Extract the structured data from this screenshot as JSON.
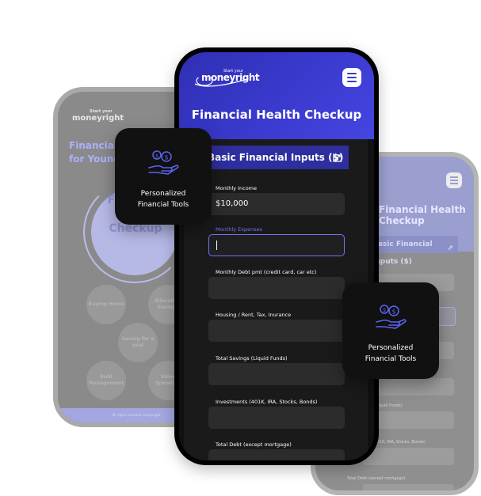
{
  "brand": {
    "start_text": "Start your",
    "name": "moneyright",
    "accent": "#3a3acf",
    "focus_color": "#6f75f2"
  },
  "left_screen": {
    "title": "Financial Health Checkup for Young",
    "ring_text": "Financial Health Checkup",
    "bubbles": [
      "Buying Home",
      "Allocating Savings",
      "Saving for a goal",
      "Debt Management",
      "Value Spending"
    ],
    "footer": "All rights reserved moneyright"
  },
  "main_screen": {
    "title": "Financial Health Checkup",
    "section_title": "Basic Financial Inputs ($)",
    "fields": [
      {
        "label": "Monthly Income",
        "value": "$10,000"
      },
      {
        "label": "Monthly Expenses",
        "value": ""
      },
      {
        "label": "Monthly Debt pmt (credit card, car etc)",
        "value": ""
      },
      {
        "label": "Housing / Rent, Tax, Inurance",
        "value": ""
      },
      {
        "label": "Total Savings (Liquid Funds)",
        "value": ""
      },
      {
        "label": "Investments (401K, IRA, Stocks, Bonds)",
        "value": ""
      },
      {
        "label": "Total Debt (except mortgage)",
        "value": ""
      }
    ]
  },
  "right_screen": {
    "title": "Financial Health Checkup",
    "section_title": "Basic Financial Inputs ($)",
    "labels": [
      "Investments (401K, IRA, Stocks, Bonds)",
      "Total Savings (Liquid Funds)",
      "Total Debt (except mortgage)"
    ]
  },
  "feature_cards": [
    {
      "line1": "Personalized",
      "line2": "Financial Tools",
      "icon": "hand-coins-icon"
    },
    {
      "line1": "Personalized",
      "line2": "Financial Tools",
      "icon": "hand-coins-icon"
    }
  ]
}
